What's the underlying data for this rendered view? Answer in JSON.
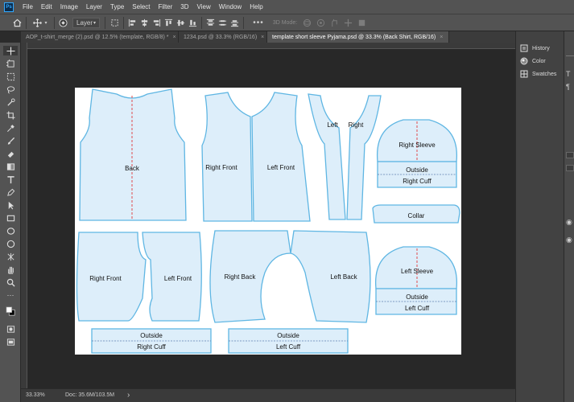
{
  "app": {
    "logo_text": "Ps"
  },
  "menu": [
    "File",
    "Edit",
    "Image",
    "Layer",
    "Type",
    "Select",
    "Filter",
    "3D",
    "View",
    "Window",
    "Help"
  ],
  "options_bar": {
    "auto_select_target": "Layer",
    "mode_label": "3D Mode:",
    "more_label": "•••"
  },
  "tabs": [
    {
      "label": "AOP_t-shirt_merge (2).psd @ 12.5% (template, RGB/8) *",
      "close": "×",
      "active": false
    },
    {
      "label": "1234.psd @ 33.3% (RGB/16)",
      "close": "×",
      "active": false
    },
    {
      "label": "template short sleeve Pyjama.psd @ 33.3% (Back Shirt, RGB/16)",
      "close": "×",
      "active": true
    }
  ],
  "pieces": {
    "back": "Back",
    "right_front_shirt": "Right Front",
    "left_front_shirt": "Left Front",
    "placket_left": "Left",
    "placket_right": "Right",
    "right_sleeve": "Right Sleeve",
    "right_sleeve_outside": "Outside",
    "right_sleeve_cuff": "Right Cuff",
    "collar": "Collar",
    "shorts_right_front": "Right Front",
    "shorts_left_front": "Left Front",
    "shorts_right_back": "Right Back",
    "shorts_left_back": "Left Back",
    "left_sleeve": "Left Sleeve",
    "left_sleeve_outside": "Outside",
    "left_sleeve_cuff": "Left Cuff",
    "cuff_bottom_right_outside": "Outside",
    "cuff_bottom_right": "Right Cuff",
    "cuff_bottom_left_outside": "Outside",
    "cuff_bottom_left": "Left Cuff"
  },
  "status": {
    "zoom": "33.33%",
    "doc": "Doc: 35.6M/103.5M",
    "arrow": "›"
  },
  "panels": [
    {
      "label": "History",
      "icon": "history-icon"
    },
    {
      "label": "Color",
      "icon": "color-icon"
    },
    {
      "label": "Swatches",
      "icon": "swatches-icon"
    }
  ],
  "colors": {
    "piece_fill": "#ddeefa",
    "piece_stroke": "#5fb6e3",
    "center_line": "#e03a3a",
    "canvas": "#282828",
    "ui": "#535353"
  }
}
